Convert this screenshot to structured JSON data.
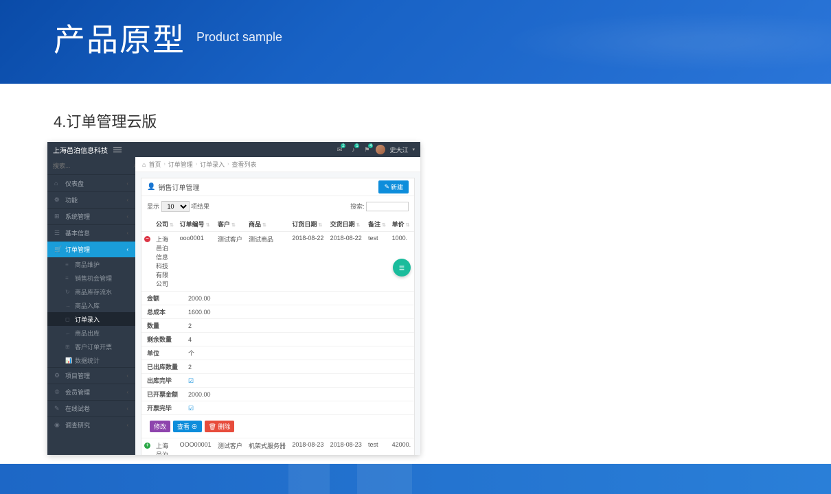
{
  "slide": {
    "title_cn": "产品原型",
    "title_en": "Product sample",
    "section": "4.订单管理云版"
  },
  "app": {
    "brand": "上海邑泊信息科技",
    "user": "史大江",
    "badges": [
      "2",
      "1",
      "4"
    ]
  },
  "sidebar": {
    "search_placeholder": "搜索...",
    "items": [
      {
        "icon": "⌂",
        "label": "仪表盘"
      },
      {
        "icon": "❁",
        "label": "功能"
      },
      {
        "icon": "⊞",
        "label": "系统管理"
      },
      {
        "icon": "☰",
        "label": "基本信息"
      },
      {
        "icon": "🛒",
        "label": "订单管理",
        "active": true
      },
      {
        "icon": "⚙",
        "label": "项目管理"
      },
      {
        "icon": "♔",
        "label": "会员管理"
      },
      {
        "icon": "✎",
        "label": "在线试卷"
      },
      {
        "icon": "◉",
        "label": "调查研究"
      }
    ],
    "sub_items": [
      {
        "icon": "≡",
        "label": "商品维护"
      },
      {
        "icon": "≡",
        "label": "销售机会管理"
      },
      {
        "icon": "↻",
        "label": "商品库存流水"
      },
      {
        "icon": "→",
        "label": "商品入库"
      },
      {
        "icon": "◻",
        "label": "订单录入",
        "selected": true
      },
      {
        "icon": "←",
        "label": "商品出库"
      },
      {
        "icon": "⊞",
        "label": "客户订单开票"
      },
      {
        "icon": "📊",
        "label": "数据统计"
      }
    ]
  },
  "breadcrumb": [
    "首页",
    "订单管理",
    "订单录入",
    "查看列表"
  ],
  "panel": {
    "title": "销售订单管理",
    "new_btn": "新建",
    "show_label": "显示",
    "show_value": "10",
    "show_suffix": "项结果",
    "search_label": "搜索:"
  },
  "table": {
    "headers": [
      "公司",
      "订单编号",
      "客户",
      "商品",
      "订货日期",
      "交货日期",
      "备注",
      "单价"
    ],
    "rows": [
      {
        "expand": "red",
        "company": "上海\n邑泊\n信息\n科技\n有限\n公司",
        "order_no": "ooo0001",
        "customer": "测试客户",
        "product": "测试商品",
        "order_date": "2018-08-22",
        "delivery_date": "2018-08-22",
        "note": "test",
        "price": "1000."
      },
      {
        "expand": "green",
        "company": "上海\n邑泊\n信息\n科技",
        "order_no": "OOO00001",
        "customer": "测试客户",
        "product": "机架式服务器",
        "order_date": "2018-08-23",
        "delivery_date": "2018-08-23",
        "note": "test",
        "price": "42000."
      }
    ]
  },
  "details": [
    {
      "label": "金额",
      "value": "2000.00"
    },
    {
      "label": "总成本",
      "value": "1600.00"
    },
    {
      "label": "数量",
      "value": "2"
    },
    {
      "label": "剩余数量",
      "value": "4"
    },
    {
      "label": "单位",
      "value": "个"
    },
    {
      "label": "已出库数量",
      "value": "2"
    },
    {
      "label": "出库完毕",
      "value": "check"
    },
    {
      "label": "已开票金额",
      "value": "2000.00"
    },
    {
      "label": "开票完毕",
      "value": "check"
    }
  ],
  "actions": {
    "edit": "修改",
    "view": "查看",
    "delete": "删除"
  }
}
